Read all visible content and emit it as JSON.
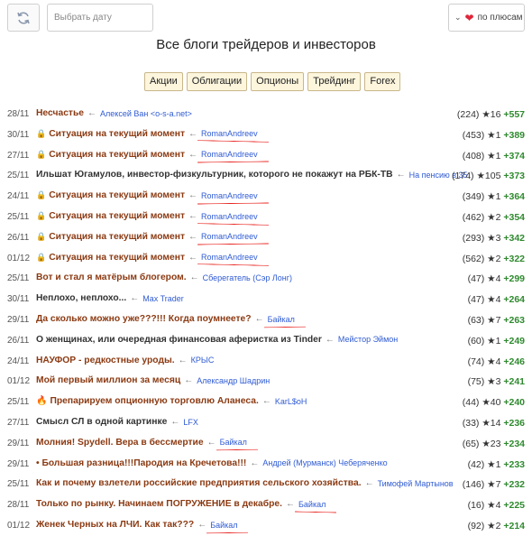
{
  "toolbar": {
    "date_placeholder": "Выбрать дату",
    "sort_label": "по плюсам"
  },
  "page_title": "Все блоги трейдеров и инвесторов",
  "tabs": [
    "Акции",
    "Облигации",
    "Опционы",
    "Трейдинг",
    "Forex"
  ],
  "rows": [
    {
      "date": "28/11",
      "lock": false,
      "fire": false,
      "dark": false,
      "title": "Несчастье",
      "author": "Алексей Ван <o-s-a.net>",
      "comments": "(224)",
      "stars": "★16",
      "plus": "+557"
    },
    {
      "date": "30/11",
      "lock": true,
      "fire": false,
      "dark": false,
      "title": "Ситуация на текущий момент",
      "author": "RomanAndreev",
      "comments": "(453)",
      "stars": "★1",
      "plus": "+389"
    },
    {
      "date": "27/11",
      "lock": true,
      "fire": false,
      "dark": false,
      "title": "Ситуация на текущий момент",
      "author": "RomanAndreev",
      "comments": "(408)",
      "stars": "★1",
      "plus": "+374"
    },
    {
      "date": "25/11",
      "lock": false,
      "fire": false,
      "dark": true,
      "title": "Ильшат Югамулов, инвестор-физкультурник, которого не покажут на РБК-ТВ",
      "author": "На пенсию в 35",
      "comments": "(174)",
      "stars": "★105",
      "plus": "+373"
    },
    {
      "date": "24/11",
      "lock": true,
      "fire": false,
      "dark": false,
      "title": "Ситуация на текущий момент",
      "author": "RomanAndreev",
      "comments": "(349)",
      "stars": "★1",
      "plus": "+364"
    },
    {
      "date": "25/11",
      "lock": true,
      "fire": false,
      "dark": false,
      "title": "Ситуация на текущий момент",
      "author": "RomanAndreev",
      "comments": "(462)",
      "stars": "★2",
      "plus": "+354"
    },
    {
      "date": "26/11",
      "lock": true,
      "fire": false,
      "dark": false,
      "title": "Ситуация на текущий момент",
      "author": "RomanAndreev",
      "comments": "(293)",
      "stars": "★3",
      "plus": "+342"
    },
    {
      "date": "01/12",
      "lock": true,
      "fire": false,
      "dark": false,
      "title": "Ситуация на текущий момент",
      "author": "RomanAndreev",
      "comments": "(562)",
      "stars": "★2",
      "plus": "+322"
    },
    {
      "date": "25/11",
      "lock": false,
      "fire": false,
      "dark": false,
      "title": "Вот и стал я матёрым блогером.",
      "author": "Сберегатель (Сэр Лонг)",
      "comments": "(47)",
      "stars": "★4",
      "plus": "+299"
    },
    {
      "date": "30/11",
      "lock": false,
      "fire": false,
      "dark": true,
      "title": "Неплохо, неплохо...",
      "author": "Max Trader",
      "comments": "(47)",
      "stars": "★4",
      "plus": "+264"
    },
    {
      "date": "29/11",
      "lock": false,
      "fire": false,
      "dark": false,
      "title": "Да сколько можно уже???!!! Когда поумнеете?",
      "author": "Байкал",
      "comments": "(63)",
      "stars": "★7",
      "plus": "+263"
    },
    {
      "date": "26/11",
      "lock": false,
      "fire": false,
      "dark": true,
      "title": "О женщинах, или очередная финансовая аферистка из Tinder",
      "author": "Мейстор Эймон",
      "comments": "(60)",
      "stars": "★1",
      "plus": "+249"
    },
    {
      "date": "24/11",
      "lock": false,
      "fire": false,
      "dark": false,
      "title": "НАУФОР - редкостные уроды.",
      "author": "КРЫС",
      "comments": "(74)",
      "stars": "★4",
      "plus": "+246"
    },
    {
      "date": "01/12",
      "lock": false,
      "fire": false,
      "dark": false,
      "title": "Мой первый миллион за месяц",
      "author": "Александр Шадрин",
      "comments": "(75)",
      "stars": "★3",
      "plus": "+241"
    },
    {
      "date": "25/11",
      "lock": false,
      "fire": true,
      "dark": false,
      "title": "Препарируем опционную торговлю Аланеса.",
      "author": "KarL$oH",
      "comments": "(44)",
      "stars": "★40",
      "plus": "+240"
    },
    {
      "date": "27/11",
      "lock": false,
      "fire": false,
      "dark": true,
      "title": "Смысл СЛ в одной картинке",
      "author": "LFX",
      "comments": "(33)",
      "stars": "★14",
      "plus": "+236"
    },
    {
      "date": "29/11",
      "lock": false,
      "fire": false,
      "dark": false,
      "title": "Молния! Spydell. Вера в бессмертие",
      "author": "Байкал",
      "comments": "(65)",
      "stars": "★23",
      "plus": "+234"
    },
    {
      "date": "29/11",
      "lock": false,
      "fire": false,
      "dark": false,
      "title": "• Большая разница!!!Пародия на Кречетова!!!",
      "author": "Андрей (Мурманск) Чеберяченко",
      "comments": "(42)",
      "stars": "★1",
      "plus": "+233"
    },
    {
      "date": "25/11",
      "lock": false,
      "fire": false,
      "dark": false,
      "title": "Как и почему взлетели российские предприятия сельского хозяйства.",
      "author": "Тимофей Мартынов",
      "comments": "(146)",
      "stars": "★7",
      "plus": "+232"
    },
    {
      "date": "28/11",
      "lock": false,
      "fire": false,
      "dark": false,
      "title": "Только по рынку. Начинаем ПОГРУЖЕНИЕ в декабре.",
      "author": "Байкал",
      "comments": "(16)",
      "stars": "★4",
      "plus": "+225"
    },
    {
      "date": "01/12",
      "lock": false,
      "fire": false,
      "dark": false,
      "title": "Женек Черных на ЛЧИ. Как так???",
      "author": "Байкал",
      "comments": "(92)",
      "stars": "★2",
      "plus": "+214"
    }
  ]
}
